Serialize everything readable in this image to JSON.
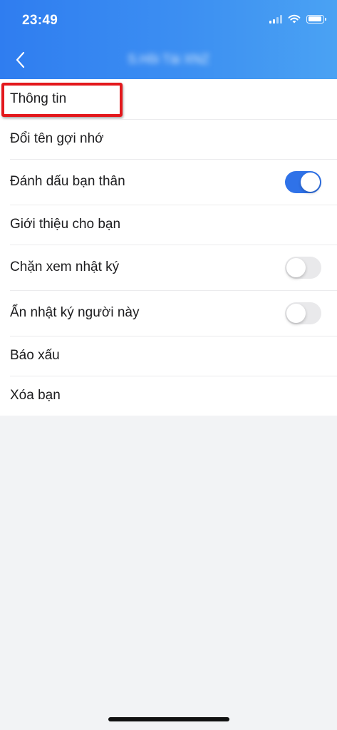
{
  "status_bar": {
    "time": "23:49"
  },
  "nav": {
    "title": "S.Hồi Tài XNZ"
  },
  "menu": {
    "items": [
      {
        "label": "Thông tin",
        "highlighted": true
      },
      {
        "label": "Đổi tên gợi nhớ"
      },
      {
        "label": "Đánh dấu bạn thân",
        "toggle": true,
        "on": true
      },
      {
        "label": "Giới thiệu cho bạn"
      },
      {
        "label": "Chặn xem nhật ký",
        "toggle": true,
        "on": false
      },
      {
        "label": "Ẩn nhật ký người này",
        "toggle": true,
        "on": false
      },
      {
        "label": "Báo xấu"
      },
      {
        "label": "Xóa bạn"
      }
    ]
  },
  "colors": {
    "header_start": "#2f7df0",
    "header_end": "#4aa2f3",
    "toggle_on": "#2f72e8",
    "highlight": "#e3181c"
  }
}
